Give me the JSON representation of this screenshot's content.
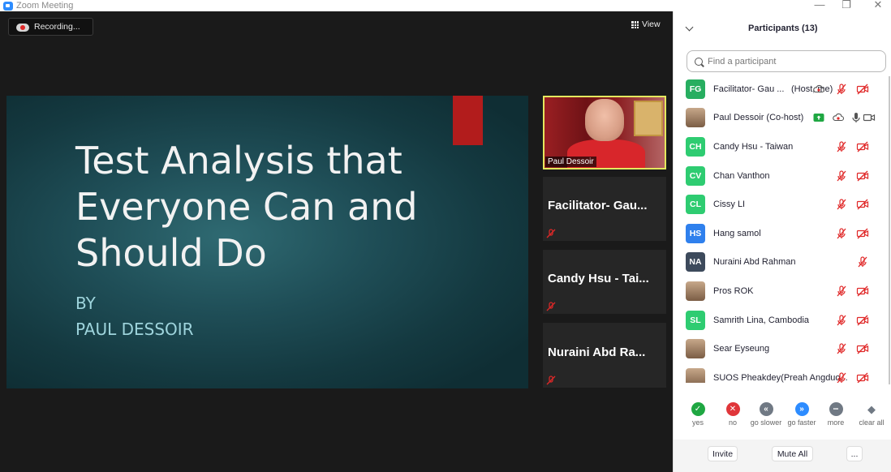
{
  "window": {
    "title": "Zoom Meeting",
    "controls": [
      "—",
      "❐",
      "✕"
    ]
  },
  "meeting": {
    "recording_label": "Recording...",
    "view_label": "View",
    "slide": {
      "title": "Test Analysis that Everyone Can and Should Do",
      "by": "BY",
      "author": "PAUL DESSOIR",
      "accent_color": "#b21c1c"
    },
    "tiles": [
      {
        "name": "Paul Dessoir",
        "video": true
      },
      {
        "name": "Facilitator-  Gau...",
        "muted": true
      },
      {
        "name": "Candy  Hsu  - Tai...",
        "muted": true
      },
      {
        "name": "Nuraini  Abd  Ra...",
        "muted": true
      }
    ]
  },
  "participants": {
    "title": "Participants (13)",
    "search_placeholder": "Find a participant",
    "list": [
      {
        "initials": "FG",
        "color": "#27ae60",
        "name": "Facilitator- Gau ...",
        "tag": "(Host, me)",
        "icons": [
          "cloud-record",
          "mic-off",
          "video-off"
        ]
      },
      {
        "initials": "",
        "color": "",
        "photo": true,
        "name": "Paul Dessoir (Co-host)",
        "tag": "",
        "icons": [
          "share-screen",
          "cloud-record",
          "mic-on",
          "video-on"
        ]
      },
      {
        "initials": "CH",
        "color": "#2ecc71",
        "name": "Candy Hsu - Taiwan",
        "tag": "",
        "icons": [
          "mic-off",
          "video-off"
        ]
      },
      {
        "initials": "CV",
        "color": "#2ecc71",
        "name": "Chan Vanthon",
        "tag": "",
        "icons": [
          "mic-off",
          "video-off"
        ]
      },
      {
        "initials": "CL",
        "color": "#2ecc71",
        "name": "Cissy LI",
        "tag": "",
        "icons": [
          "mic-off",
          "video-off"
        ]
      },
      {
        "initials": "HS",
        "color": "#2f80ed",
        "name": "Hang samol",
        "tag": "",
        "icons": [
          "mic-off",
          "video-off"
        ]
      },
      {
        "initials": "NA",
        "color": "#3d4a5c",
        "name": "Nuraini Abd Rahman",
        "tag": "",
        "icons": [
          "mic-off"
        ]
      },
      {
        "initials": "",
        "color": "",
        "photo": true,
        "name": "Pros ROK",
        "tag": "",
        "icons": [
          "mic-off",
          "video-off"
        ]
      },
      {
        "initials": "SL",
        "color": "#2ecc71",
        "name": "Samrith Lina, Cambodia",
        "tag": "",
        "icons": [
          "mic-off",
          "video-off"
        ]
      },
      {
        "initials": "",
        "color": "",
        "photo": true,
        "name": "Sear Eyseung",
        "tag": "",
        "icons": [
          "mic-off",
          "video-off"
        ]
      },
      {
        "initials": "",
        "color": "",
        "photo": true,
        "name": "SUOS Pheakdey(Preah Angduo...",
        "tag": "",
        "icons": [
          "mic-off",
          "video-off"
        ]
      }
    ],
    "reactions": [
      {
        "label": "yes",
        "icon": "check-icon",
        "color": "#1fa742"
      },
      {
        "label": "no",
        "icon": "x-icon",
        "color": "#e0363a"
      },
      {
        "label": "go slower",
        "icon": "rewind-icon",
        "color": "#707984"
      },
      {
        "label": "go faster",
        "icon": "fast-forward-icon",
        "color": "#2d8cff"
      },
      {
        "label": "more",
        "icon": "ellipsis-icon",
        "color": "#707984"
      },
      {
        "label": "clear all",
        "icon": "eraser-icon",
        "color": "#707984"
      }
    ],
    "footer": {
      "invite": "Invite",
      "mute_all": "Mute All",
      "more": "..."
    }
  }
}
